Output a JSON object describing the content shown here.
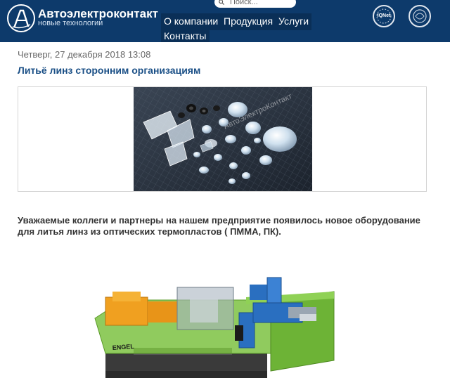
{
  "header": {
    "brand_name": "Автоэлектроконтакт",
    "brand_tagline": "новые технологии",
    "search_placeholder": "Поиск...",
    "nav": [
      {
        "label": "О компании"
      },
      {
        "label": "Продукция"
      },
      {
        "label": "Услуги"
      },
      {
        "label": "Контакты"
      }
    ],
    "badges": [
      {
        "label": "IQNet"
      },
      {
        "label": ""
      }
    ]
  },
  "article": {
    "date": "Четверг, 27 декабря 2018 13:08",
    "title": "Литьё линз сторонним организациям",
    "watermark": "АвтоЭлектроКонтакт",
    "body": "Уважаемые коллеги и партнеры на нашем предприятие появилось новое оборудование для литья линз  из оптических термопластов ( ПММА, ПК).",
    "machine_brand": "ENGEL"
  },
  "colors": {
    "header_bg": "#0d3a6b",
    "nav_bg": "#0a2f57",
    "title": "#1a4f86",
    "machine_green": "#7cc242",
    "machine_orange": "#f0a020",
    "machine_blue": "#2a6fc0"
  }
}
